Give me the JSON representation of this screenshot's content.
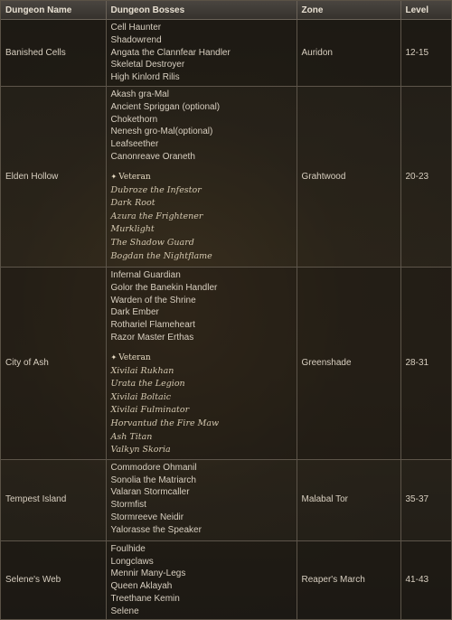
{
  "headers": {
    "name": "Dungeon Name",
    "bosses": "Dungeon Bosses",
    "zone": "Zone",
    "level": "Level"
  },
  "veteran_label": "Veteran",
  "dungeons": [
    {
      "name": "Banished Cells",
      "zone": "Auridon",
      "level": "12-15",
      "bosses": [
        "Cell Haunter",
        "Shadowrend",
        "Angata the Clannfear Handler",
        "Skeletal Destroyer",
        "High Kinlord Rilis"
      ],
      "veteran": []
    },
    {
      "name": "Elden Hollow",
      "zone": "Grahtwood",
      "level": "20-23",
      "bosses": [
        "Akash gra-Mal",
        "Ancient Spriggan (optional)",
        "Chokethorn",
        "Nenesh gro-Mal(optional)",
        "Leafseether",
        "Canonreave Oraneth"
      ],
      "veteran": [
        "Dubroze the Infestor",
        "Dark Root",
        "Azura the Frightener",
        "Murklight",
        "The Shadow Guard",
        "Bogdan the Nightflame"
      ]
    },
    {
      "name": "City of Ash",
      "zone": "Greenshade",
      "level": "28-31",
      "bosses": [
        "Infernal Guardian",
        "Golor the Banekin Handler",
        "Warden of the Shrine",
        "Dark Ember",
        "Rothariel Flameheart",
        "Razor Master Erthas"
      ],
      "veteran": [
        "Xivilai Rukhan",
        "Urata the Legion",
        "Xivilai Boltaic",
        "Xivilai Fulminator",
        "Horvantud the Fire Maw",
        "Ash Titan",
        "Valkyn Skoria"
      ]
    },
    {
      "name": "Tempest Island",
      "zone": "Malabal Tor",
      "level": "35-37",
      "bosses": [
        "Commodore Ohmanil",
        "Sonolia the Matriarch",
        "Valaran Stormcaller",
        "Stormfist",
        "Stormreeve Neidir",
        "Yalorasse the Speaker"
      ],
      "veteran": []
    },
    {
      "name": "Selene's Web",
      "zone": "Reaper's March",
      "level": "41-43",
      "bosses": [
        "Foulhide",
        "Longclaws",
        "Mennir Many-Legs",
        "Queen Aklayah",
        "Treethane Kemin",
        "Selene"
      ],
      "veteran": []
    }
  ]
}
